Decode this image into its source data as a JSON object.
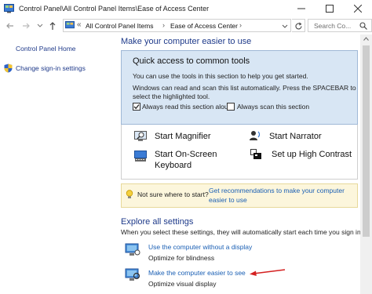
{
  "window": {
    "title": "Control Panel\\All Control Panel Items\\Ease of Access Center"
  },
  "address_bar": {
    "breadcrumb_prefix": "«",
    "crumbs": [
      "All Control Panel Items",
      "Ease of Access Center"
    ],
    "search_placeholder": "Search Co..."
  },
  "left_pane": {
    "home_link": "Control Panel Home",
    "signin_link": "Change sign-in settings"
  },
  "main": {
    "heading": "Make your computer easier to use",
    "quick_access": {
      "title": "Quick access to common tools",
      "line1": "You can use the tools in this section to help you get started.",
      "line2": "Windows can read and scan this list automatically.  Press the SPACEBAR to",
      "line3": "select the highlighted tool.",
      "checkbox_read_label": "Always read this section aloud",
      "checkbox_read_checked": true,
      "checkbox_scan_label": "Always scan this section",
      "checkbox_scan_checked": false
    },
    "tools": {
      "magnifier": "Start Magnifier",
      "narrator": "Start Narrator",
      "osk_line1": "Start On-Screen",
      "osk_line2": "Keyboard",
      "high_contrast": "Set up High Contrast"
    },
    "tip": {
      "text": "Not sure where to start?",
      "link_line1": "Get recommendations to make your computer",
      "link_line2": "easier to use"
    },
    "explore": {
      "heading": "Explore all settings",
      "subtext": "When you select these settings, they will automatically start each time you sign in.",
      "items": [
        {
          "link": "Use the computer without a display",
          "desc": "Optimize for blindness"
        },
        {
          "link": "Make the computer easier to see",
          "desc": "Optimize visual display"
        }
      ]
    }
  },
  "colors": {
    "link": "#1a5fb4",
    "heading": "#1e3a8a",
    "qa_panel_bg": "#d8e6f4",
    "tip_bg": "#fcf6dc",
    "annotation_arrow": "#d42020"
  },
  "icons": [
    "control-panel-icon",
    "minimize-icon",
    "maximize-icon",
    "close-icon",
    "back-arrow-icon",
    "forward-arrow-icon",
    "up-arrow-icon",
    "refresh-icon",
    "search-icon",
    "shield-icon",
    "magnifier-icon",
    "narrator-icon",
    "keyboard-icon",
    "high-contrast-icon",
    "lightbulb-icon",
    "monitor-icon",
    "annotation-arrow-icon"
  ]
}
